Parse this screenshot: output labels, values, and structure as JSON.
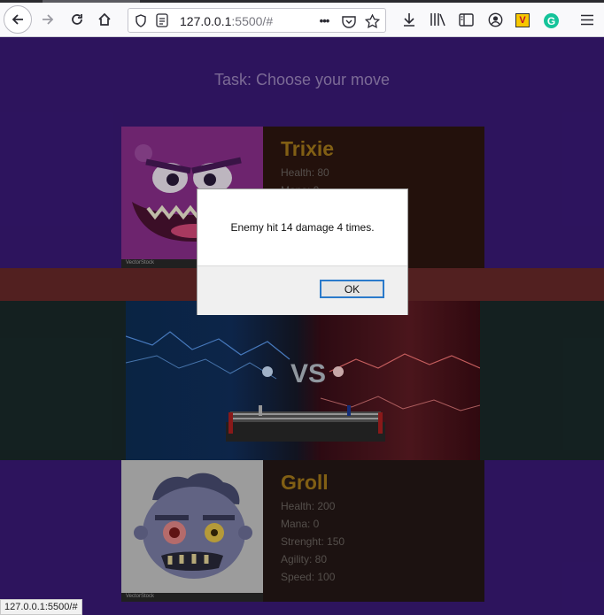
{
  "browser": {
    "url_host": "127.0.0.1",
    "url_rest": ":5500/#",
    "page_actions_glyph": "•••"
  },
  "page": {
    "task_label": "Task: Choose your move"
  },
  "enemy": {
    "name": "Trixie",
    "health_label": "Health: 80",
    "mana_label": "Mana: 0",
    "image_watermark": "VectorStock"
  },
  "player": {
    "name": "Groll",
    "health_label": "Health: 200",
    "mana_label": "Mana: 0",
    "strength_label": "Strenght: 150",
    "agility_label": "Agility: 80",
    "speed_label": "Speed: 100",
    "image_watermark": "VectorStock"
  },
  "arena": {
    "vs_text": "VS"
  },
  "dialog": {
    "message": "Enemy hit 14 damage 4 times.",
    "ok_label": "OK"
  },
  "statusbar": {
    "text": "127.0.0.1:5500/#"
  },
  "icons": [
    "back-arrow-icon",
    "forward-arrow-icon",
    "reload-icon",
    "home-icon",
    "shield-icon",
    "info-icon",
    "pocket-icon",
    "bookmark-star-icon",
    "download-icon",
    "library-icon",
    "sidebar-icon",
    "account-icon",
    "vivaldi-extension-icon",
    "grammarly-extension-icon",
    "hamburger-menu-icon"
  ],
  "colors": {
    "page_bg": "#3a1a78",
    "name_gold": "#a67a1a",
    "ok_focus": "#2a7acb"
  }
}
